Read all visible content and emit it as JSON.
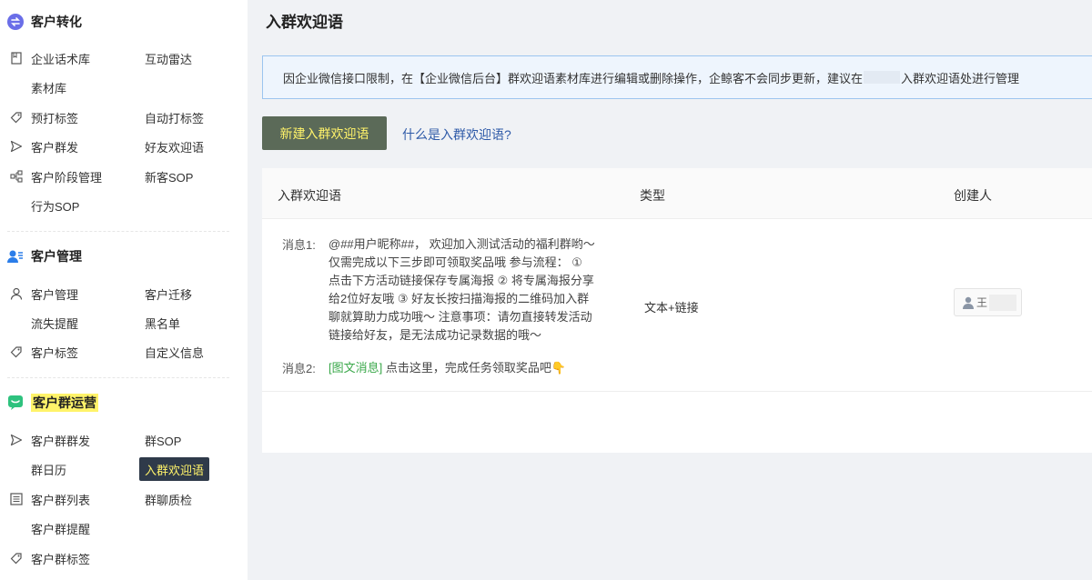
{
  "sidebar": {
    "sections": [
      {
        "title": "客户转化",
        "items": [
          {
            "col1": "企业话术库",
            "col2": "互动雷达"
          },
          {
            "col1": "素材库",
            "col2": ""
          },
          {
            "col1": "预打标签",
            "col2": "自动打标签"
          },
          {
            "col1": "客户群发",
            "col2": "好友欢迎语"
          },
          {
            "col1": "客户阶段管理",
            "col2": "新客SOP"
          },
          {
            "col1": "行为SOP",
            "col2": ""
          }
        ]
      },
      {
        "title": "客户管理",
        "items": [
          {
            "col1": "客户管理",
            "col2": "客户迁移"
          },
          {
            "col1": "流失提醒",
            "col2": "黑名单"
          },
          {
            "col1": "客户标签",
            "col2": "自定义信息"
          }
        ]
      },
      {
        "title": "客户群运营",
        "items": [
          {
            "col1": "客户群群发",
            "col2": "群SOP"
          },
          {
            "col1": "群日历",
            "col2": "入群欢迎语"
          },
          {
            "col1": "客户群列表",
            "col2": "群聊质检"
          },
          {
            "col1": "客户群提醒",
            "col2": ""
          },
          {
            "col1": "客户群标签",
            "col2": ""
          }
        ]
      }
    ]
  },
  "main": {
    "title": "入群欢迎语",
    "notice": "因企业微信接口限制，在【企业微信后台】群欢迎语素材库进行编辑或删除操作，企鲸客不会同步更新，建议在",
    "notice_tail": "入群欢迎语处进行管理",
    "new_button": "新建入群欢迎语",
    "help_link": "什么是入群欢迎语?",
    "table": {
      "headers": [
        "入群欢迎语",
        "类型",
        "创建人"
      ],
      "rows": [
        {
          "msg1_label": "消息1:",
          "msg1_lines": [
            "@##用户昵称##， 欢迎加入测试活动的福利群哟～",
            "仅需完成以下三步即可领取奖品哦 参与流程： ①",
            "点击下方活动链接保存专属海报 ② 将专属海报分享",
            "给2位好友哦 ③ 好友长按扫描海报的二维码加入群",
            "聊就算助力成功哦～ 注意事项：请勿直接转发活动",
            "链接给好友，是无法成功记录数据的哦～"
          ],
          "msg2_label": "消息2:",
          "msg2_tag": "[图文消息]",
          "msg2_text": " 点击这里，完成任务领取奖品吧👇",
          "type": "文本+链接",
          "creator": "王"
        }
      ]
    }
  },
  "colors": {
    "active_bg": "#2f3a4a",
    "highlight": "#fff36a",
    "button_bg": "#5b6a58",
    "link": "#2e5aa8",
    "tag": "#3aa84a"
  }
}
